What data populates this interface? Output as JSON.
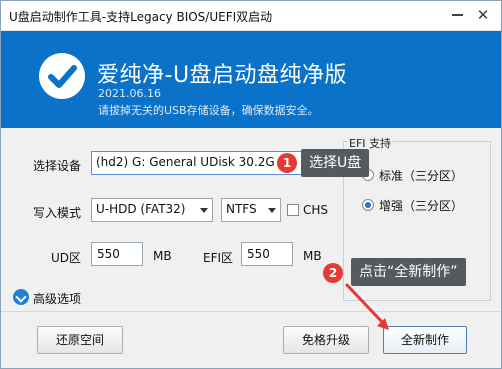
{
  "window": {
    "title": "U盘启动制作工具-支持Legacy BIOS/UEFI双启动",
    "minimize_icon": "minimize-icon",
    "close_glyph": "✕"
  },
  "banner": {
    "app_name": "爱纯净-U盘启动盘纯净版",
    "version_date": "2021.06.16",
    "warning": "请拔掉无关的USB存储设备，确保数据安全。",
    "logo_icon": "checkmark-circle-icon",
    "bg_color": "#0a72c8"
  },
  "form": {
    "device_label": "选择设备",
    "device_value": "(hd2) G: General UDisk 30.2G",
    "write_mode_label": "写入模式",
    "write_mode_value": "U-HDD (FAT32)",
    "fs_value": "NTFS",
    "chs_label": "CHS",
    "chs_checked": false,
    "ud_label": "UD区",
    "ud_value": "550",
    "ud_unit": "MB",
    "efi_label": "EFI区",
    "efi_value": "550",
    "efi_unit": "MB"
  },
  "efi_support": {
    "title": "EFI 支持",
    "options": [
      {
        "label": "标准（三分区）",
        "selected": false
      },
      {
        "label": "增强（三分区）",
        "selected": true
      }
    ]
  },
  "advanced": {
    "label": "高级选项",
    "icon": "chevron-down-circle-icon"
  },
  "buttons": {
    "restore": "还原空间",
    "upgrade": "免格升级",
    "create": "全新制作"
  },
  "callouts": [
    {
      "number": "1",
      "text": "选择U盘"
    },
    {
      "number": "2",
      "text": "点击“全新制作”"
    }
  ],
  "colors": {
    "accent": "#0a72c8",
    "badge": "#e53935",
    "callout_bg": "#555a5f"
  }
}
